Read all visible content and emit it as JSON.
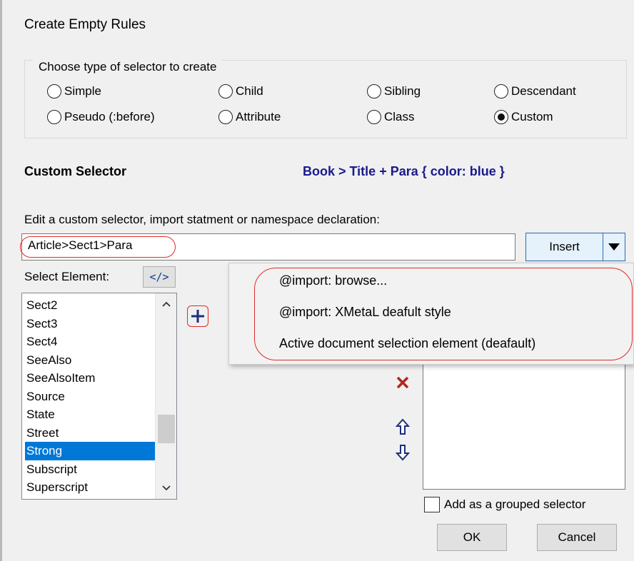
{
  "dialog": {
    "title": "Create Empty Rules"
  },
  "selector_type": {
    "group_label": "Choose type of selector to create",
    "options": [
      {
        "label": "Simple",
        "selected": false
      },
      {
        "label": "Child",
        "selected": false
      },
      {
        "label": "Sibling",
        "selected": false
      },
      {
        "label": "Descendant",
        "selected": false
      },
      {
        "label": "Pseudo (:before)",
        "selected": false
      },
      {
        "label": "Attribute",
        "selected": false
      },
      {
        "label": "Class",
        "selected": false
      },
      {
        "label": "Custom",
        "selected": true
      }
    ]
  },
  "custom": {
    "heading": "Custom Selector",
    "example": "Book > Title + Para { color: blue }",
    "edit_label": "Edit a custom selector, import statment or namespace declaration:",
    "input_value": "Article>Sect1>Para"
  },
  "insert": {
    "label": "Insert"
  },
  "select_element": {
    "label": "Select Element:",
    "code_button": "</>",
    "items": [
      "Sect2",
      "Sect3",
      "Sect4",
      "SeeAlso",
      "SeeAlsoItem",
      "Source",
      "State",
      "Street",
      "Strong",
      "Subscript",
      "Superscript"
    ],
    "selected": "Strong"
  },
  "insert_menu": {
    "items": [
      "@import: browse...",
      "@import: XMetaL deafult style",
      "Active document selection element (deafault)"
    ]
  },
  "grouped": {
    "label": "Add as a grouped selector",
    "checked": false
  },
  "buttons": {
    "ok": "OK",
    "cancel": "Cancel"
  },
  "colors": {
    "accent": "#0078d7",
    "highlight_ring": "#e02a2a",
    "delete": "#b3261e",
    "example_text": "#1a1a8c"
  },
  "icons": [
    "plus-icon",
    "delete-x-icon",
    "arrow-up-icon",
    "arrow-down-icon",
    "dropdown-arrow-icon"
  ]
}
